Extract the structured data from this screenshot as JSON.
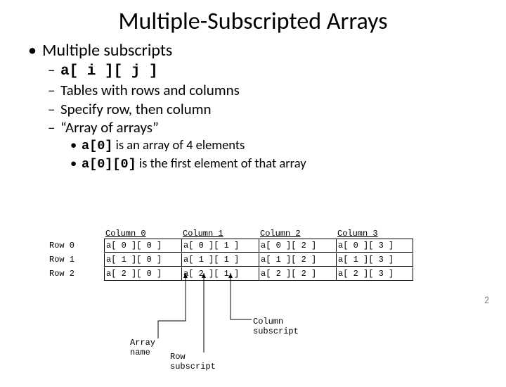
{
  "title": "Multiple-Subscripted Arrays",
  "bullets": {
    "main": "Multiple subscripts",
    "sub1": "a[ i ][ j ]",
    "sub2": "Tables with rows and columns",
    "sub3": "Specify row, then column",
    "sub4": "“Array of arrays”",
    "subsub1_code": "a[0]",
    "subsub1_text": " is an array of 4 elements",
    "subsub2_code": "a[0][0]",
    "subsub2_text": " is the first element of that array"
  },
  "diagram": {
    "col_headers": [
      "Column 0",
      "Column 1",
      "Column 2",
      "Column 3"
    ],
    "rows": [
      {
        "label": "Row 0",
        "cells": [
          "a[ 0 ][ 0 ]",
          "a[ 0 ][ 1 ]",
          "a[ 0 ][ 2 ]",
          "a[ 0 ][ 3 ]"
        ]
      },
      {
        "label": "Row 1",
        "cells": [
          "a[ 1 ][ 0 ]",
          "a[ 1 ][ 1 ]",
          "a[ 1 ][ 2 ]",
          "a[ 1 ][ 3 ]"
        ]
      },
      {
        "label": "Row 2",
        "cells": [
          "a[ 2 ][ 0 ]",
          "a[ 2 ][ 1 ]",
          "a[ 2 ][ 2 ]",
          "a[ 2 ][ 3 ]"
        ]
      }
    ],
    "annotations": {
      "array_name": "Array name",
      "row_subscript": "Row subscript",
      "column_subscript": "Column subscript"
    }
  },
  "page_number": "2"
}
